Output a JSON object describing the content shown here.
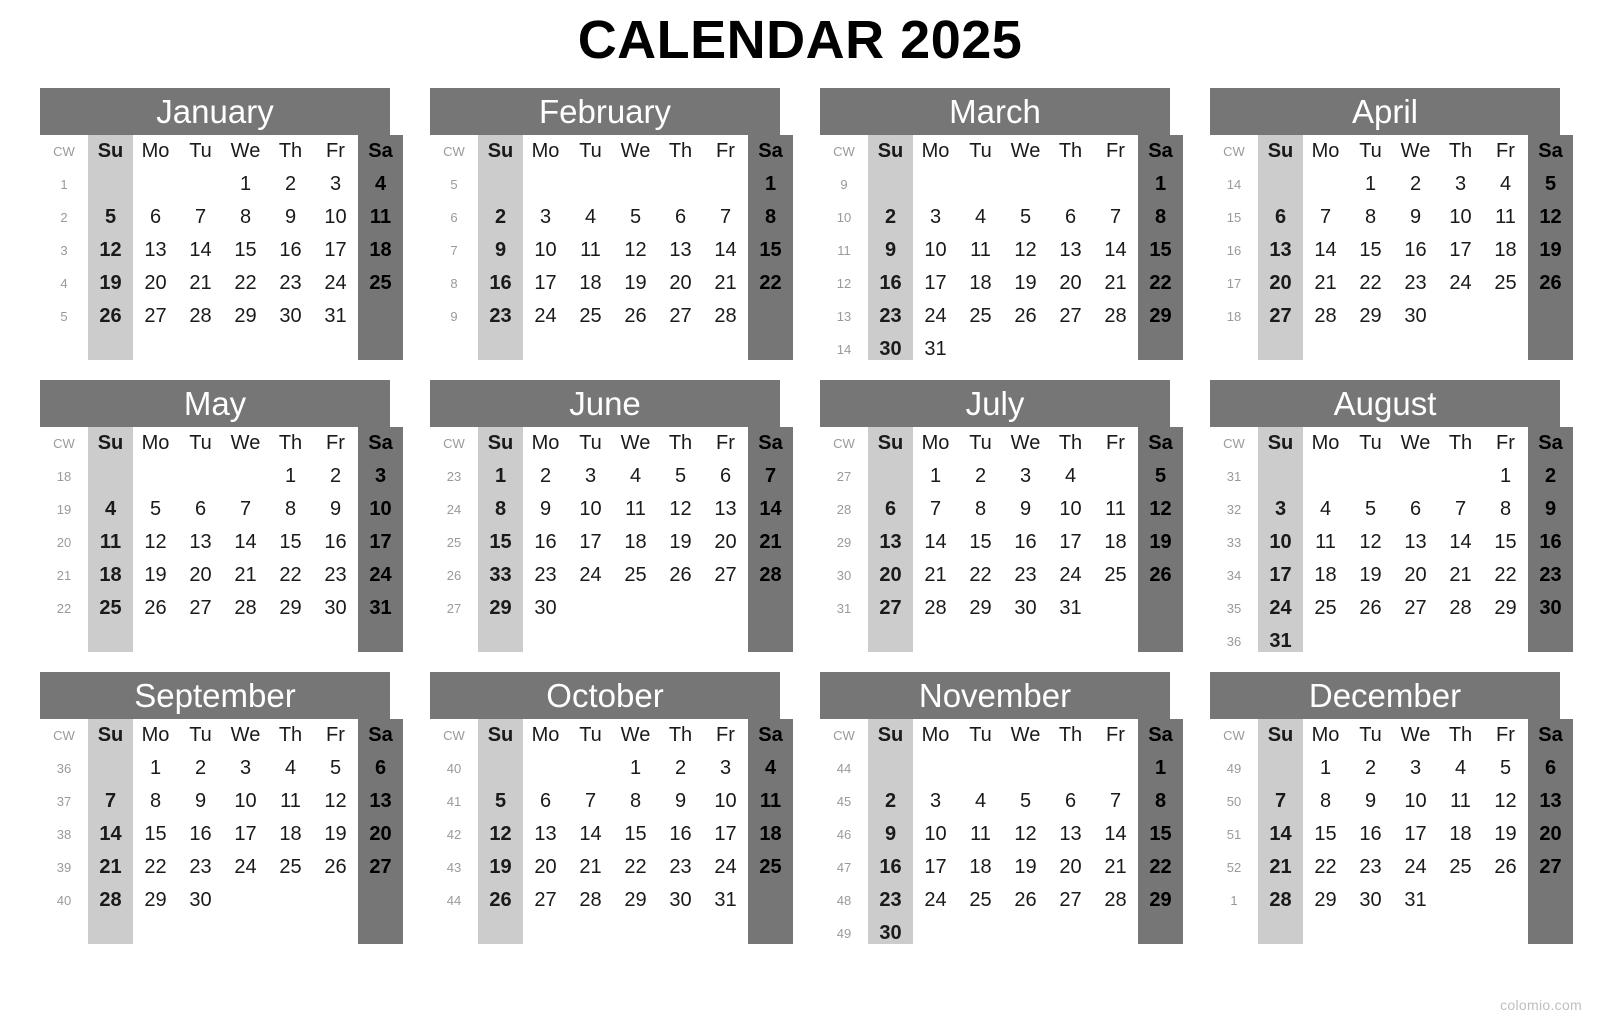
{
  "page": {
    "title": "CALENDAR 2025",
    "watermark": "colomio.com"
  },
  "colors": {
    "header_bar": "#767676",
    "saturday_column": "#767676",
    "sunday_column": "#cccccc",
    "page_background": "#ffffff",
    "title_text": "#000000",
    "cw_text": "#9a9a9a"
  },
  "weekday_headers": [
    "CW",
    "Su",
    "Mo",
    "Tu",
    "We",
    "Th",
    "Fr",
    "Sa"
  ],
  "months": [
    {
      "name": "January",
      "cw": [
        "1",
        "2",
        "3",
        "4",
        "5"
      ],
      "rows": [
        [
          "",
          "",
          "",
          "1",
          "2",
          "3",
          "4"
        ],
        [
          "5",
          "6",
          "7",
          "8",
          "9",
          "10",
          "11"
        ],
        [
          "12",
          "13",
          "14",
          "15",
          "16",
          "17",
          "18"
        ],
        [
          "19",
          "20",
          "21",
          "22",
          "23",
          "24",
          "25"
        ],
        [
          "26",
          "27",
          "28",
          "29",
          "30",
          "31",
          ""
        ]
      ]
    },
    {
      "name": "February",
      "cw": [
        "5",
        "6",
        "7",
        "8",
        "9"
      ],
      "rows": [
        [
          "",
          "",
          "",
          "",
          "",
          "",
          "1"
        ],
        [
          "2",
          "3",
          "4",
          "5",
          "6",
          "7",
          "8"
        ],
        [
          "9",
          "10",
          "11",
          "12",
          "13",
          "14",
          "15"
        ],
        [
          "16",
          "17",
          "18",
          "19",
          "20",
          "21",
          "22"
        ],
        [
          "23",
          "24",
          "25",
          "26",
          "27",
          "28",
          ""
        ]
      ]
    },
    {
      "name": "March",
      "cw": [
        "9",
        "10",
        "11",
        "12",
        "13",
        "14"
      ],
      "rows": [
        [
          "",
          "",
          "",
          "",
          "",
          "",
          "1"
        ],
        [
          "2",
          "3",
          "4",
          "5",
          "6",
          "7",
          "8"
        ],
        [
          "9",
          "10",
          "11",
          "12",
          "13",
          "14",
          "15"
        ],
        [
          "16",
          "17",
          "18",
          "19",
          "20",
          "21",
          "22"
        ],
        [
          "23",
          "24",
          "25",
          "26",
          "27",
          "28",
          "29"
        ],
        [
          "30",
          "31",
          "",
          "",
          "",
          "",
          ""
        ]
      ]
    },
    {
      "name": "April",
      "cw": [
        "14",
        "15",
        "16",
        "17",
        "18"
      ],
      "rows": [
        [
          "",
          "",
          "1",
          "2",
          "3",
          "4",
          "5"
        ],
        [
          "6",
          "7",
          "8",
          "9",
          "10",
          "11",
          "12"
        ],
        [
          "13",
          "14",
          "15",
          "16",
          "17",
          "18",
          "19"
        ],
        [
          "20",
          "21",
          "22",
          "23",
          "24",
          "25",
          "26"
        ],
        [
          "27",
          "28",
          "29",
          "30",
          "",
          "",
          ""
        ]
      ]
    },
    {
      "name": "May",
      "cw": [
        "18",
        "19",
        "20",
        "21",
        "22"
      ],
      "rows": [
        [
          "",
          "",
          "",
          "",
          "1",
          "2",
          "3"
        ],
        [
          "4",
          "5",
          "6",
          "7",
          "8",
          "9",
          "10"
        ],
        [
          "11",
          "12",
          "13",
          "14",
          "15",
          "16",
          "17"
        ],
        [
          "18",
          "19",
          "20",
          "21",
          "22",
          "23",
          "24"
        ],
        [
          "25",
          "26",
          "27",
          "28",
          "29",
          "30",
          "31"
        ]
      ]
    },
    {
      "name": "June",
      "cw": [
        "23",
        "24",
        "25",
        "26",
        "27"
      ],
      "rows": [
        [
          "1",
          "2",
          "3",
          "4",
          "5",
          "6",
          "7"
        ],
        [
          "8",
          "9",
          "10",
          "11",
          "12",
          "13",
          "14"
        ],
        [
          "15",
          "16",
          "17",
          "18",
          "19",
          "20",
          "21"
        ],
        [
          "33",
          "23",
          "24",
          "25",
          "26",
          "27",
          "28"
        ],
        [
          "29",
          "30",
          "",
          "",
          "",
          "",
          ""
        ]
      ]
    },
    {
      "name": "July",
      "cw": [
        "27",
        "28",
        "29",
        "30",
        "31"
      ],
      "rows": [
        [
          "",
          "1",
          "2",
          "3",
          "4",
          "",
          "5"
        ],
        [
          "6",
          "7",
          "8",
          "9",
          "10",
          "11",
          "12"
        ],
        [
          "13",
          "14",
          "15",
          "16",
          "17",
          "18",
          "19"
        ],
        [
          "20",
          "21",
          "22",
          "23",
          "24",
          "25",
          "26"
        ],
        [
          "27",
          "28",
          "29",
          "30",
          "31",
          "",
          ""
        ]
      ]
    },
    {
      "name": "August",
      "cw": [
        "31",
        "32",
        "33",
        "34",
        "35",
        "36"
      ],
      "rows": [
        [
          "",
          "",
          "",
          "",
          "",
          "1",
          "2"
        ],
        [
          "3",
          "4",
          "5",
          "6",
          "7",
          "8",
          "9"
        ],
        [
          "10",
          "11",
          "12",
          "13",
          "14",
          "15",
          "16"
        ],
        [
          "17",
          "18",
          "19",
          "20",
          "21",
          "22",
          "23"
        ],
        [
          "24",
          "25",
          "26",
          "27",
          "28",
          "29",
          "30"
        ],
        [
          "31",
          "",
          "",
          "",
          "",
          "",
          ""
        ]
      ]
    },
    {
      "name": "September",
      "cw": [
        "36",
        "37",
        "38",
        "39",
        "40"
      ],
      "rows": [
        [
          "",
          "1",
          "2",
          "3",
          "4",
          "5",
          "6"
        ],
        [
          "7",
          "8",
          "9",
          "10",
          "11",
          "12",
          "13"
        ],
        [
          "14",
          "15",
          "16",
          "17",
          "18",
          "19",
          "20"
        ],
        [
          "21",
          "22",
          "23",
          "24",
          "25",
          "26",
          "27"
        ],
        [
          "28",
          "29",
          "30",
          "",
          "",
          "",
          ""
        ]
      ]
    },
    {
      "name": "October",
      "cw": [
        "40",
        "41",
        "42",
        "43",
        "44"
      ],
      "rows": [
        [
          "",
          "",
          "",
          "1",
          "2",
          "3",
          "4"
        ],
        [
          "5",
          "6",
          "7",
          "8",
          "9",
          "10",
          "11"
        ],
        [
          "12",
          "13",
          "14",
          "15",
          "16",
          "17",
          "18"
        ],
        [
          "19",
          "20",
          "21",
          "22",
          "23",
          "24",
          "25"
        ],
        [
          "26",
          "27",
          "28",
          "29",
          "30",
          "31",
          ""
        ]
      ]
    },
    {
      "name": "November",
      "cw": [
        "44",
        "45",
        "46",
        "47",
        "48",
        "49"
      ],
      "rows": [
        [
          "",
          "",
          "",
          "",
          "",
          "",
          "1"
        ],
        [
          "2",
          "3",
          "4",
          "5",
          "6",
          "7",
          "8"
        ],
        [
          "9",
          "10",
          "11",
          "12",
          "13",
          "14",
          "15"
        ],
        [
          "16",
          "17",
          "18",
          "19",
          "20",
          "21",
          "22"
        ],
        [
          "23",
          "24",
          "25",
          "26",
          "27",
          "28",
          "29"
        ],
        [
          "30",
          "",
          "",
          "",
          "",
          "",
          ""
        ]
      ]
    },
    {
      "name": "December",
      "cw": [
        "49",
        "50",
        "51",
        "52",
        "1"
      ],
      "rows": [
        [
          "",
          "1",
          "2",
          "3",
          "4",
          "5",
          "6"
        ],
        [
          "7",
          "8",
          "9",
          "10",
          "11",
          "12",
          "13"
        ],
        [
          "14",
          "15",
          "16",
          "17",
          "18",
          "19",
          "20"
        ],
        [
          "21",
          "22",
          "23",
          "24",
          "25",
          "26",
          "27"
        ],
        [
          "28",
          "29",
          "30",
          "31",
          "",
          "",
          ""
        ]
      ]
    }
  ]
}
